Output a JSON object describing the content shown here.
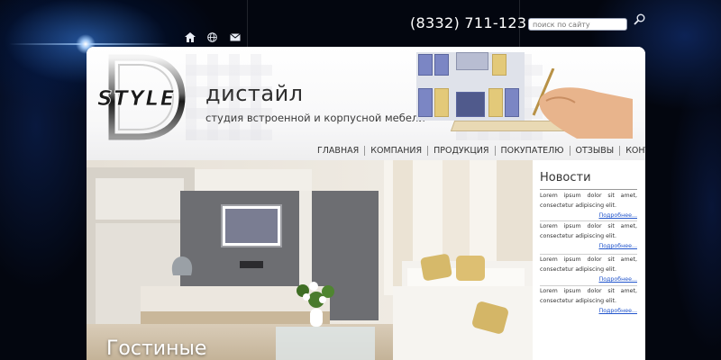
{
  "header": {
    "phone": "(8332) 711-123",
    "search": {
      "placeholder": "поиск по сайту"
    },
    "top_icons": [
      "home-icon",
      "globe-icon",
      "mail-icon"
    ],
    "brand": "дистайл",
    "tagline": "студия встроенной и корпусной мебели",
    "logo_text": "STYLE"
  },
  "nav": {
    "items": [
      {
        "label": "ГЛАВНАЯ"
      },
      {
        "label": "КОМПАНИЯ"
      },
      {
        "label": "ПРОДУКЦИЯ"
      },
      {
        "label": "ПОКУПАТЕЛЮ"
      },
      {
        "label": "ОТЗЫВЫ"
      },
      {
        "label": "КОНТАКТЫ"
      }
    ]
  },
  "hero": {
    "caption": "Гостиные"
  },
  "news": {
    "title": "Новости",
    "items": [
      {
        "text": "Lorem ipsum dolor sit amet,",
        "text2": "consectetur adipiscing elit.",
        "more": "Подробнее..."
      },
      {
        "text": "Lorem ipsum dolor sit amet,",
        "text2": "consectetur adipiscing elit.",
        "more": "Подробнее..."
      },
      {
        "text": "Lorem ipsum dolor sit amet,",
        "text2": "consectetur adipiscing elit.",
        "more": "Подробнее..."
      },
      {
        "text": "Lorem ipsum dolor sit amet,",
        "text2": "consectetur adipiscing elit.",
        "more": "Подробнее..."
      }
    ]
  },
  "colors": {
    "background": "#03060f",
    "accent_glow": "#3c8cff",
    "link": "#2255cc"
  }
}
